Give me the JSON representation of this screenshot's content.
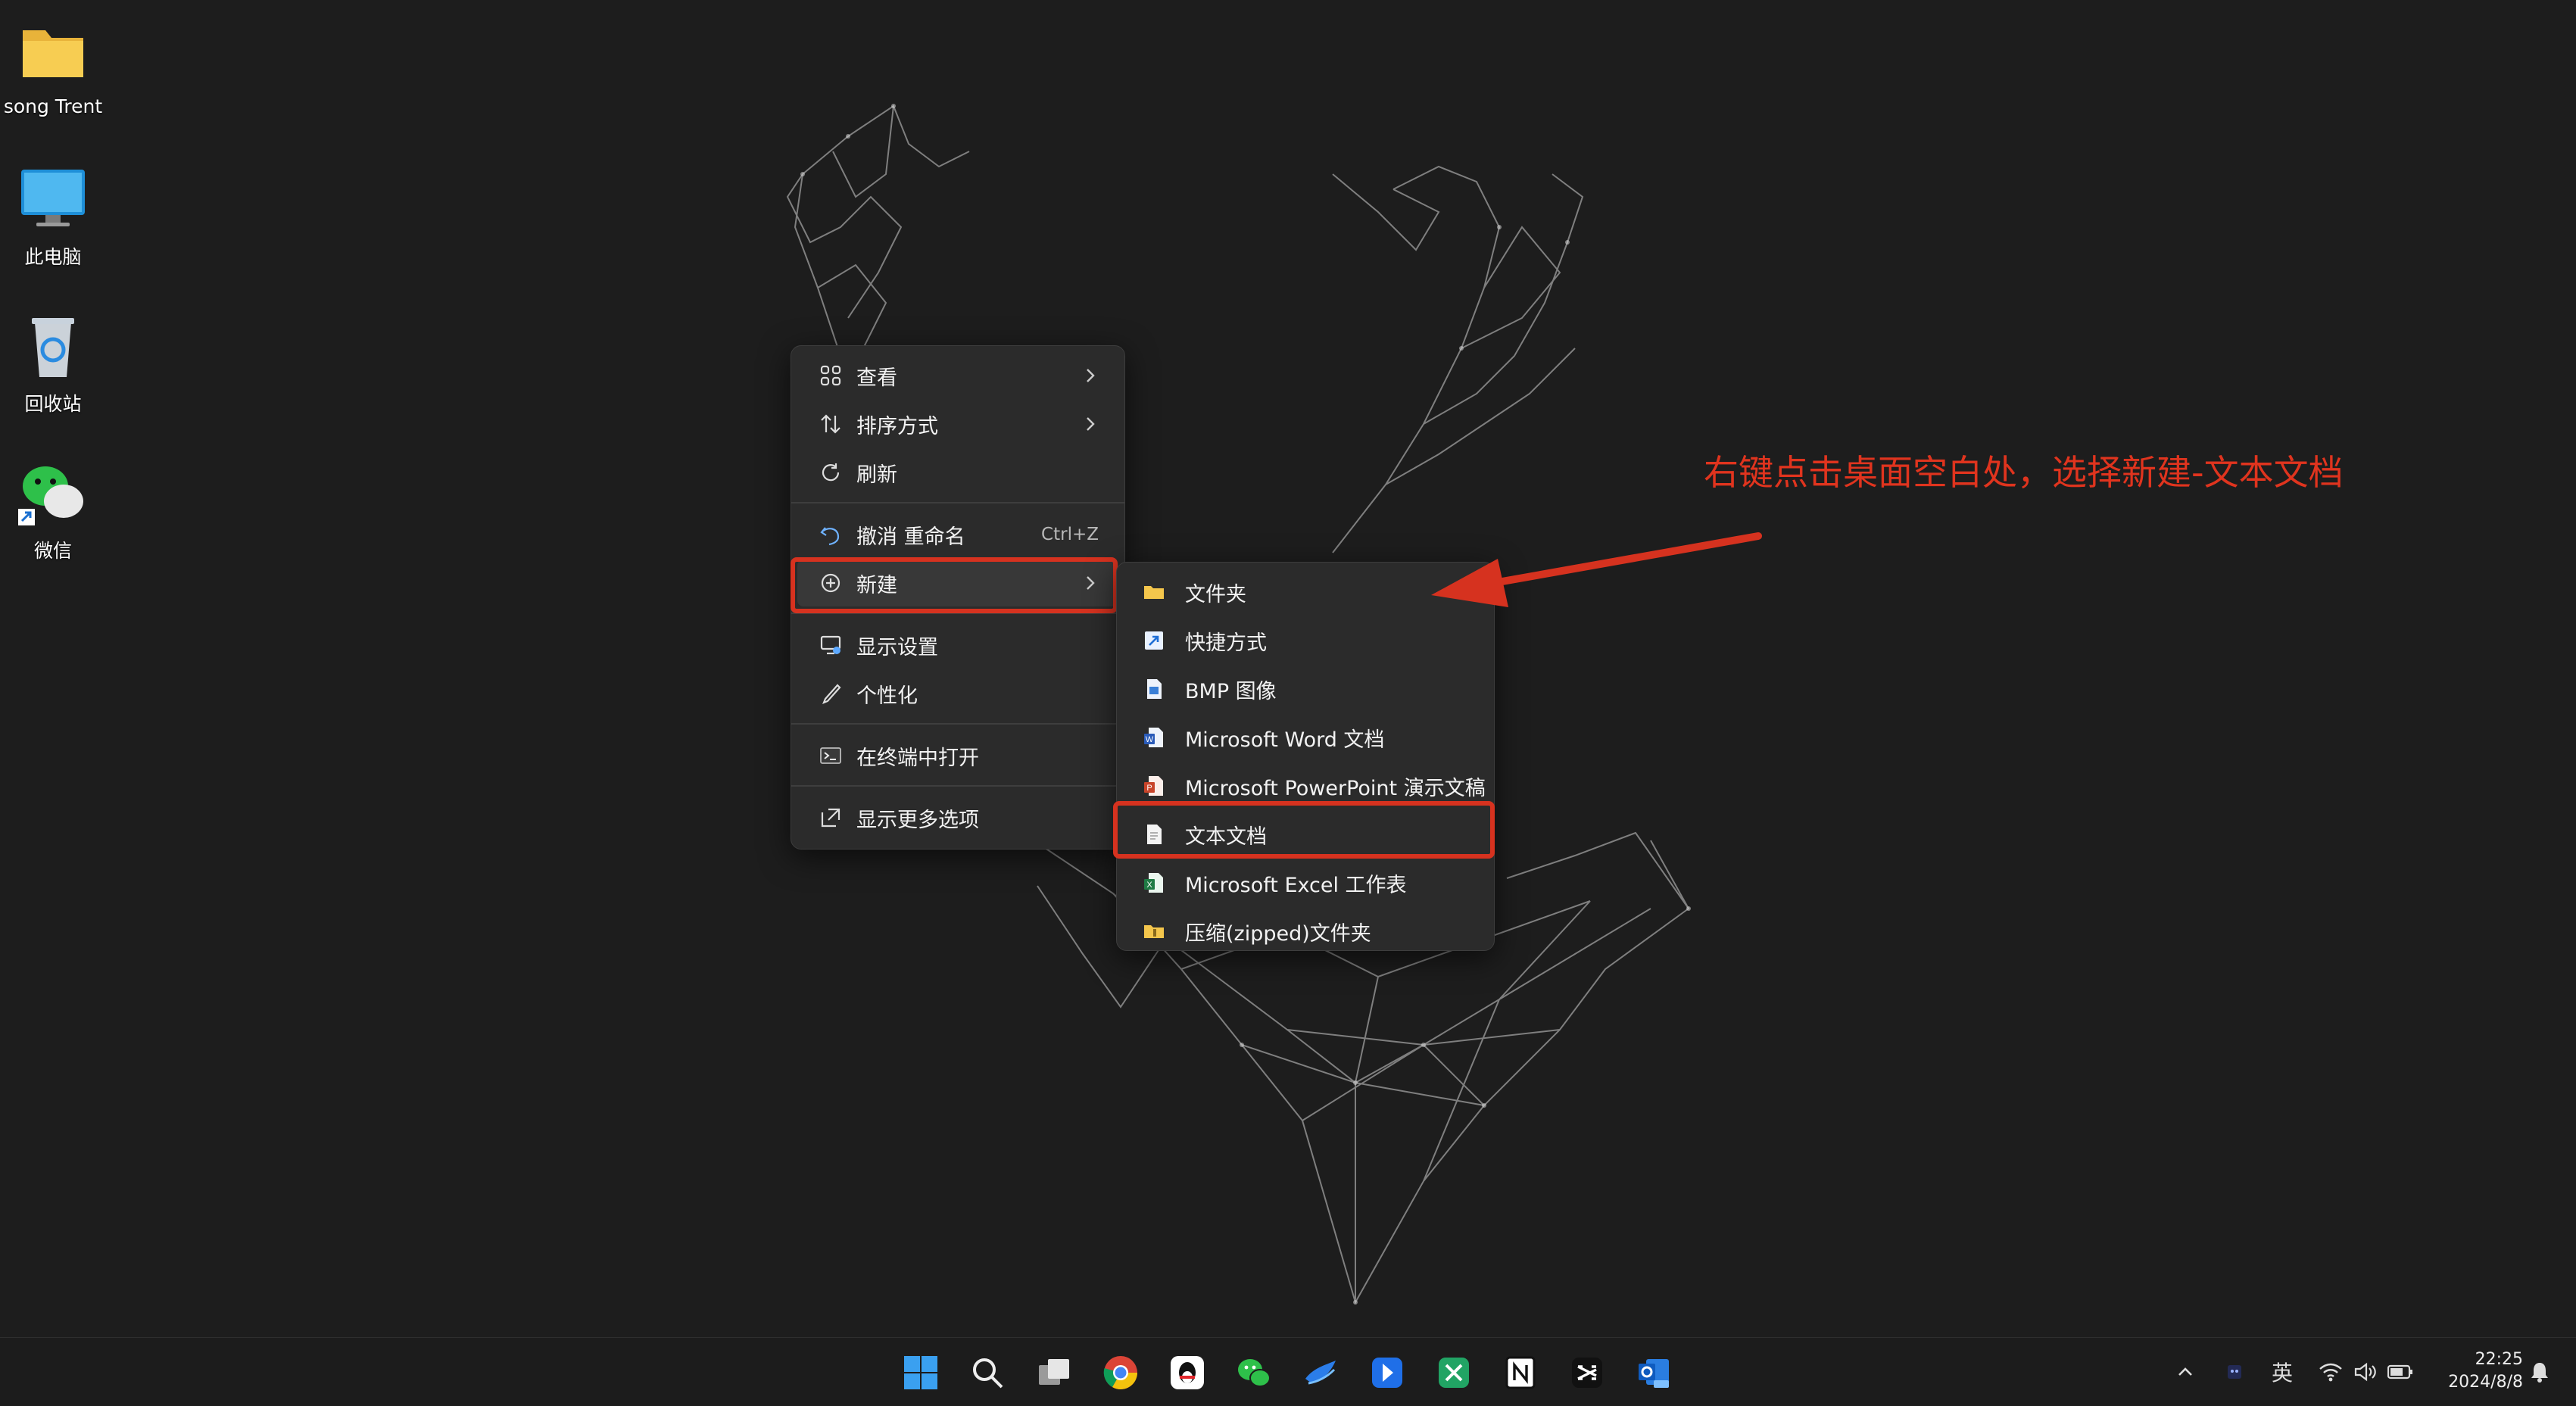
{
  "desktop": {
    "icons": [
      {
        "label": "song Trent"
      },
      {
        "label": "此电脑"
      },
      {
        "label": "回收站"
      },
      {
        "label": "微信"
      }
    ]
  },
  "context_menu": {
    "items": [
      {
        "label": "查看",
        "icon": "grid-icon",
        "has_submenu": true
      },
      {
        "label": "排序方式",
        "icon": "sort-icon",
        "has_submenu": true
      },
      {
        "label": "刷新",
        "icon": "refresh-icon"
      },
      {
        "label": "撤消 重命名",
        "icon": "undo-icon",
        "shortcut": "Ctrl+Z"
      },
      {
        "label": "新建",
        "icon": "new-plus-icon",
        "has_submenu": true
      },
      {
        "label": "显示设置",
        "icon": "display-settings-icon"
      },
      {
        "label": "个性化",
        "icon": "brush-icon"
      },
      {
        "label": "在终端中打开",
        "icon": "terminal-icon"
      },
      {
        "label": "显示更多选项",
        "icon": "more-options-icon"
      }
    ]
  },
  "submenu_new": {
    "items": [
      {
        "label": "文件夹",
        "icon": "folder-icon"
      },
      {
        "label": "快捷方式",
        "icon": "shortcut-icon"
      },
      {
        "label": "BMP 图像",
        "icon": "bmp-icon"
      },
      {
        "label": "Microsoft Word 文档",
        "icon": "word-icon"
      },
      {
        "label": "Microsoft PowerPoint 演示文稿",
        "icon": "powerpoint-icon"
      },
      {
        "label": "文本文档",
        "icon": "text-document-icon"
      },
      {
        "label": "Microsoft Excel 工作表",
        "icon": "excel-icon"
      },
      {
        "label": "压缩(zipped)文件夹",
        "icon": "zip-folder-icon"
      }
    ]
  },
  "annotation": {
    "text": "右键点击桌面空白处，选择新建-文本文档",
    "color": "#e0341e"
  },
  "taskbar": {
    "apps": [
      "windows-start-icon",
      "search-icon",
      "task-view-icon",
      "chrome-icon",
      "qq-icon",
      "wechat-icon",
      "app-bird-icon",
      "app-arrow-icon",
      "app-green-x-icon",
      "notion-icon",
      "capcut-icon",
      "outlook-new-icon"
    ],
    "tray": {
      "ime": "英",
      "time": "22:25",
      "date": "2024/8/8"
    }
  }
}
